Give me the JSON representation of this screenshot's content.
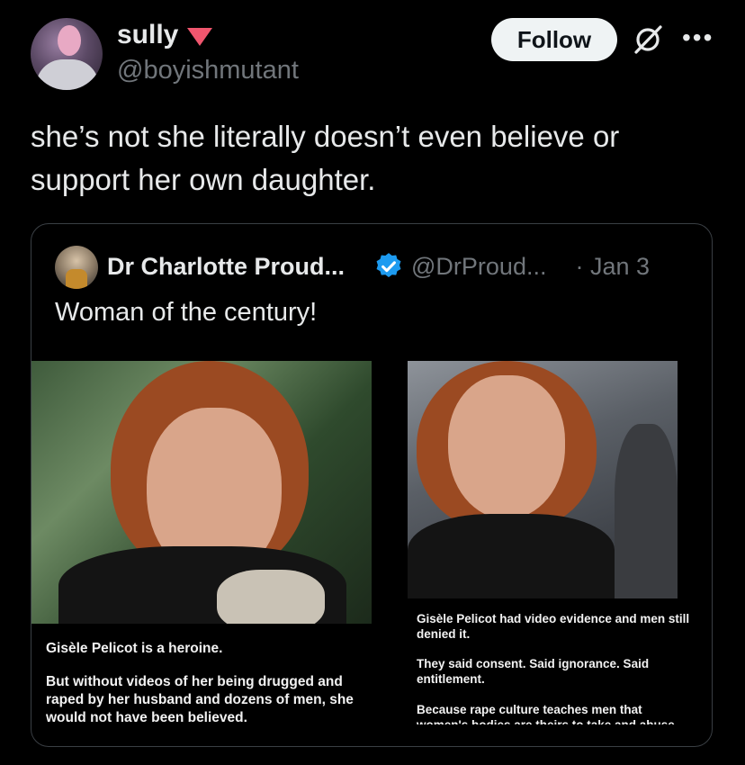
{
  "author": {
    "display_name": "sully",
    "handle": "@boyishmutant",
    "badge_color": "#f0566e"
  },
  "actions": {
    "follow_label": "Follow",
    "grok_icon": "grok-icon",
    "more_icon": "more-icon"
  },
  "tweet": {
    "text": "she’s not she literally doesn’t even believe or support her own daughter."
  },
  "quote": {
    "name": "Dr Charlotte Proud...",
    "handle": "@DrProud...",
    "date": "· Jan 3",
    "text": "Woman of the century!",
    "verified_color": "#1d9bf0",
    "media": {
      "left_caption_1": "Gisèle Pelicot is a heroine.",
      "left_caption_2": "But without videos of her being drugged and raped by her husband and dozens of men, she would not have been believed.",
      "right_caption_1": "Gisèle Pelicot had video evidence and men still denied it.",
      "right_caption_2": "They said consent. Said ignorance. Said entitlement.",
      "right_caption_3": "Because rape culture teaches men that women's bodies are theirs to take and abuse."
    }
  }
}
